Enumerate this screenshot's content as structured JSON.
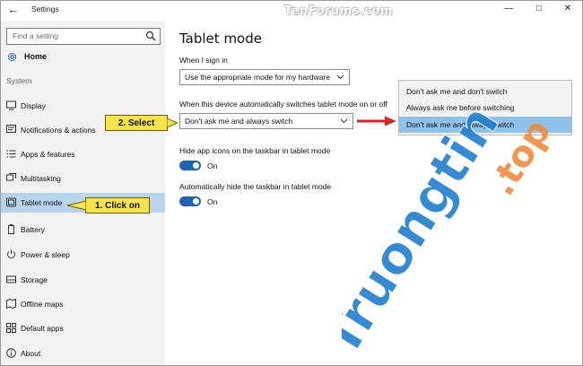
{
  "window": {
    "title": "Settings",
    "watermark": "TenForums.com",
    "back_icon": "back-arrow-icon",
    "controls": [
      "minimize",
      "maximize",
      "close"
    ]
  },
  "sidebar": {
    "search_placeholder": "Find a setting",
    "home_label": "Home",
    "section_label": "System",
    "items": [
      {
        "label": "Display",
        "icon": "display-icon"
      },
      {
        "label": "Notifications & actions",
        "icon": "notifications-icon"
      },
      {
        "label": "Apps & features",
        "icon": "apps-icon"
      },
      {
        "label": "Multitasking",
        "icon": "multitasking-icon"
      },
      {
        "label": "Tablet mode",
        "icon": "tablet-icon",
        "selected": true
      },
      {
        "label": "Battery",
        "icon": "battery-icon"
      },
      {
        "label": "Power & sleep",
        "icon": "power-icon"
      },
      {
        "label": "Storage",
        "icon": "storage-icon"
      },
      {
        "label": "Offline maps",
        "icon": "map-icon"
      },
      {
        "label": "Default apps",
        "icon": "default-apps-icon"
      },
      {
        "label": "About",
        "icon": "info-icon"
      }
    ]
  },
  "content": {
    "title": "Tablet mode",
    "signin_label": "When I sign in",
    "signin_value": "Use the appropriate mode for my hardware",
    "switch_label": "When this device automatically switches tablet mode on or off",
    "switch_value": "Don't ask me and always switch",
    "hide_icons_label": "Hide app icons on the taskbar in tablet mode",
    "hide_icons_state": "On",
    "hide_taskbar_label": "Automatically hide the taskbar in tablet mode",
    "hide_taskbar_state": "On"
  },
  "popup": {
    "options": [
      "Don't ask me and don't switch",
      "Always ask me before switching",
      "Don't ask me and always switch"
    ],
    "selected_index": 2
  },
  "callouts": {
    "click_on": "1. Click on",
    "select": "2. Select"
  },
  "brand_watermark": "Truongtin.top",
  "colors": {
    "accent": "#1f63b6",
    "selected_nav": "#b8d4ec",
    "popup_selected": "#8ec1ec",
    "callout": "#f7e34a",
    "arrow": "#e02020",
    "watermark_blue": "#1f7fd0",
    "watermark_orange": "#f08a3c"
  }
}
